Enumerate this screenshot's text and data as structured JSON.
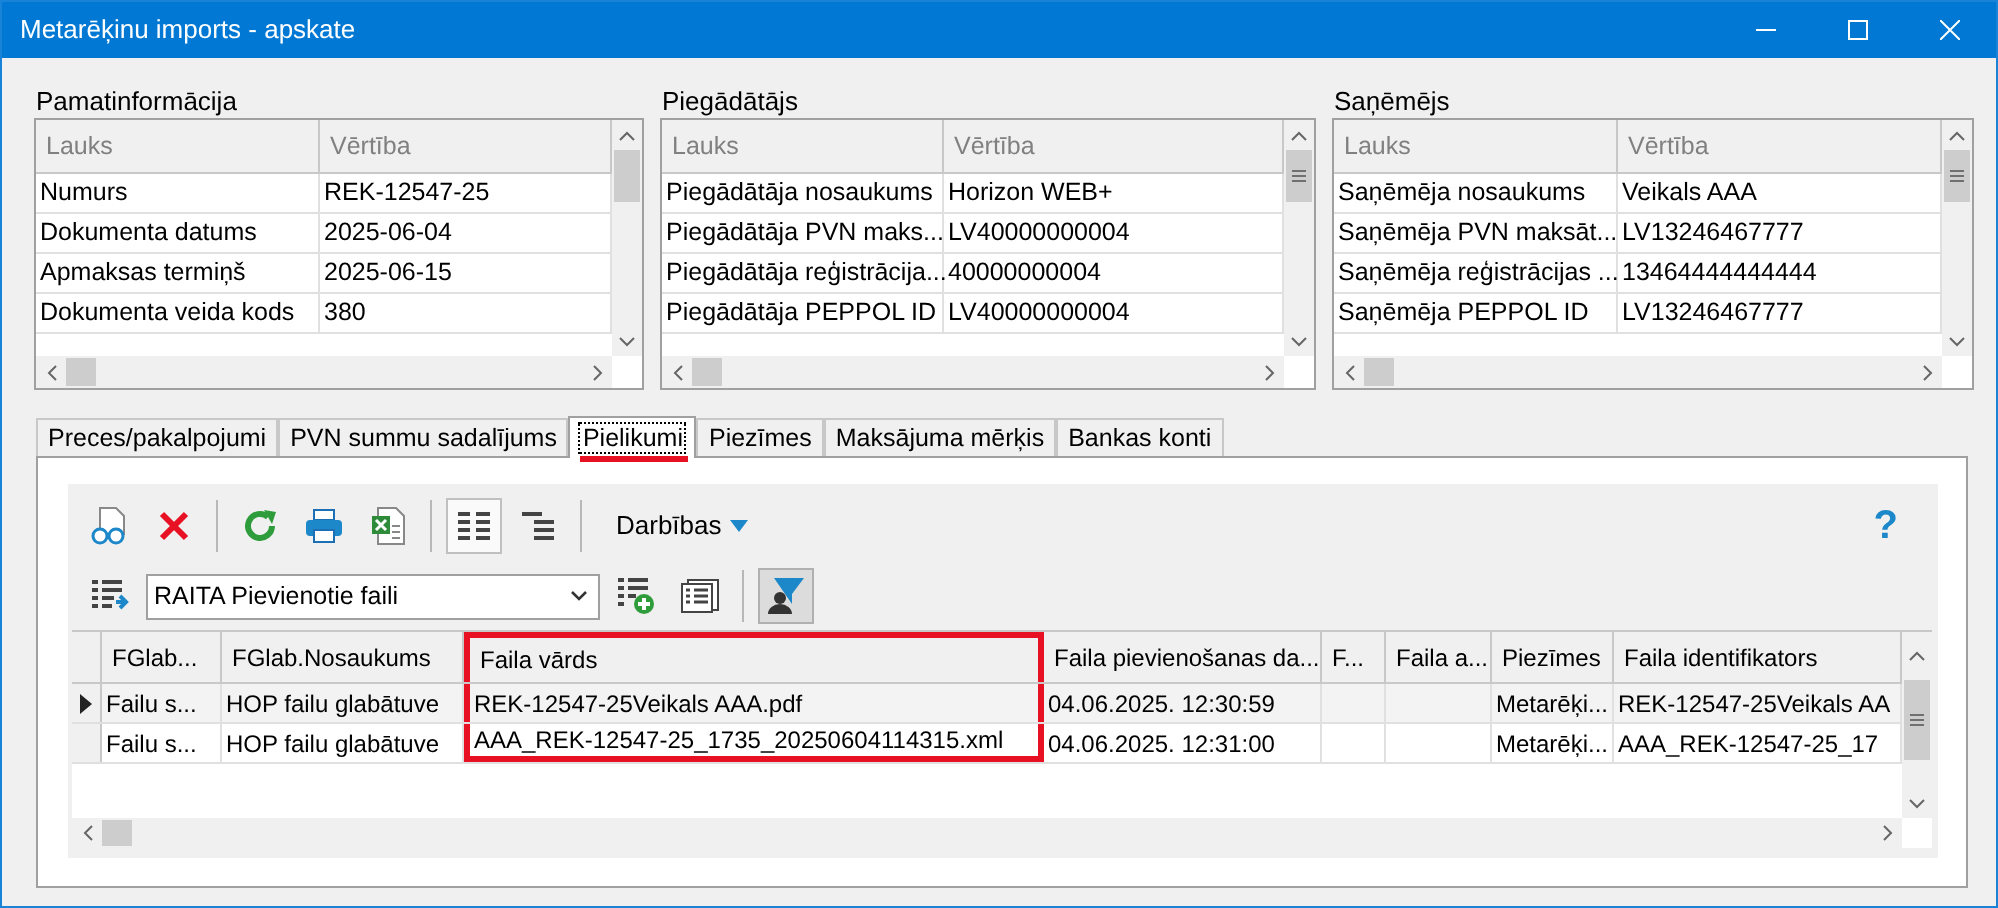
{
  "window": {
    "title": "Metarēķinu imports - apskate"
  },
  "panels": [
    {
      "title": "Pamatinformācija",
      "grip": false,
      "columns": [
        "Lauks",
        "Vērtība"
      ],
      "rows": [
        [
          "Numurs",
          "REK-12547-25"
        ],
        [
          "Dokumenta datums",
          "2025-06-04"
        ],
        [
          "Apmaksas termiņš",
          "2025-06-15"
        ],
        [
          "Dokumenta veida kods",
          "380"
        ]
      ]
    },
    {
      "title": "Piegādātājs",
      "grip": true,
      "columns": [
        "Lauks",
        "Vērtība"
      ],
      "rows": [
        [
          "Piegādātāja nosaukums",
          "Horizon WEB+"
        ],
        [
          "Piegādātāja PVN maks...",
          "LV40000000004"
        ],
        [
          "Piegādātāja reģistrācija...",
          "40000000004"
        ],
        [
          "Piegādātāja PEPPOL ID",
          "LV40000000004"
        ]
      ]
    },
    {
      "title": "Saņēmējs",
      "grip": true,
      "columns": [
        "Lauks",
        "Vērtība"
      ],
      "rows": [
        [
          "Saņēmēja nosaukums",
          "Veikals AAA"
        ],
        [
          "Saņēmēja PVN maksāt...",
          "LV13246467777"
        ],
        [
          "Saņēmēja reģistrācijas ...",
          "13464444444444"
        ],
        [
          "Saņēmēja PEPPOL ID",
          "LV13246467777"
        ]
      ]
    }
  ],
  "tabs": [
    {
      "label": "Preces/pakalpojumi",
      "selected": false,
      "highlighted": false
    },
    {
      "label": "PVN summu sadalījums",
      "selected": false,
      "highlighted": false
    },
    {
      "label": "Pielikumi",
      "selected": true,
      "highlighted": true
    },
    {
      "label": "Piezīmes",
      "selected": false,
      "highlighted": false
    },
    {
      "label": "Maksājuma mērķis",
      "selected": false,
      "highlighted": false
    },
    {
      "label": "Bankas konti",
      "selected": false,
      "highlighted": false
    }
  ],
  "toolbar": {
    "actions_label": "Darbības",
    "help": "?",
    "list_view_pressed": true
  },
  "view_select": {
    "value": "RAITA Pievienotie faili"
  },
  "filter": {
    "on": true
  },
  "files": {
    "columns": [
      {
        "label": "FGlab...",
        "highlighted": false
      },
      {
        "label": "FGlab.Nosaukums",
        "highlighted": false
      },
      {
        "label": "Faila vārds",
        "highlighted": true
      },
      {
        "label": "Faila pievienošanas da...",
        "highlighted": false
      },
      {
        "label": "F...",
        "highlighted": false
      },
      {
        "label": "Faila a...",
        "highlighted": false
      },
      {
        "label": "Piezīmes",
        "highlighted": false
      },
      {
        "label": "Faila identifikators",
        "highlighted": false
      }
    ],
    "rows": [
      {
        "selected": true,
        "cells": [
          "Failu s...",
          "HOP failu glabātuve",
          "REK-12547-25Veikals AAA.pdf",
          "04.06.2025. 12:30:59",
          null,
          null,
          "Metarēķi...",
          "REK-12547-25Veikals AA"
        ]
      },
      {
        "selected": false,
        "cells": [
          "Failu s...",
          "HOP failu glabātuve",
          "AAA_REK-12547-25_1735_20250604114315.xml",
          "04.06.2025. 12:31:00",
          null,
          null,
          "Metarēķi...",
          "AAA_REK-12547-25_17"
        ]
      }
    ]
  }
}
